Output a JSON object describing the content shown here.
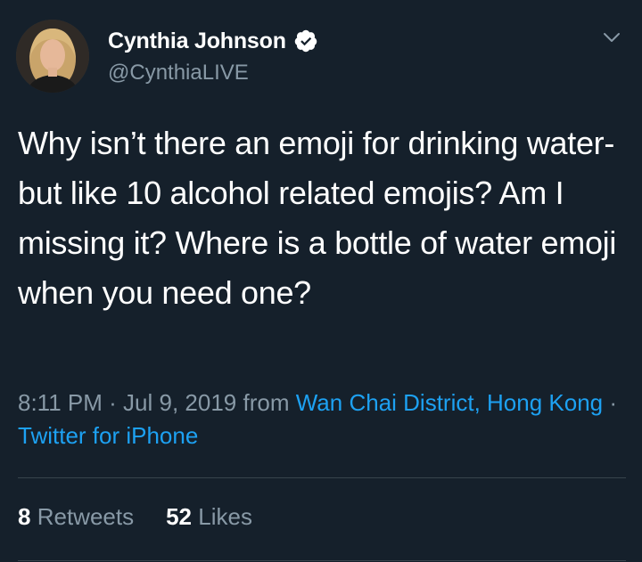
{
  "author": {
    "display_name": "Cynthia Johnson",
    "handle": "@CynthiaLIVE",
    "verified": true
  },
  "tweet": {
    "text": "Why isn’t there an emoji for drinking water- but like 10 alcohol related emojis? Am I missing it? Where is a bottle of water emoji when you need one?",
    "time": "8:11 PM",
    "date": "Jul 9, 2019",
    "from_label": "from",
    "location": "Wan Chai District, Hong Kong",
    "source": "Twitter for iPhone",
    "separator": "·"
  },
  "stats": {
    "retweets_count": "8",
    "retweets_label": "Retweets",
    "likes_count": "52",
    "likes_label": "Likes"
  },
  "icons": {
    "verified": "verified-badge-icon",
    "more": "chevron-down-icon"
  },
  "colors": {
    "background": "#15202b",
    "text": "#ffffff",
    "secondary": "#8899a6",
    "link": "#1da1f2",
    "divider": "#38444d"
  }
}
